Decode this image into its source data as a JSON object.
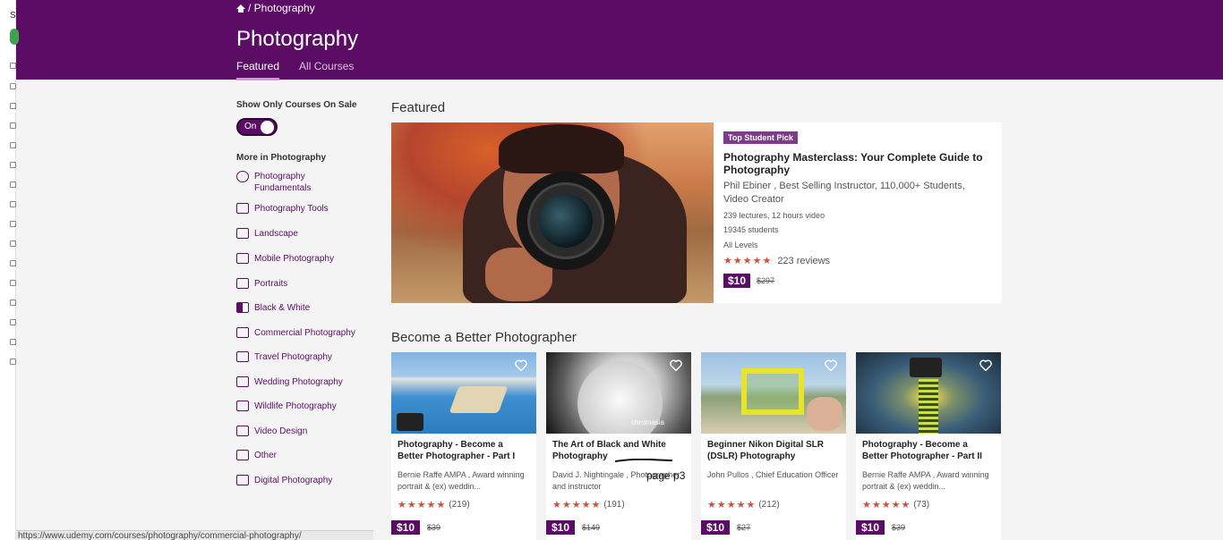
{
  "edge": {
    "letter": "S"
  },
  "header": {
    "breadcrumb": "/ Photography",
    "title": "Photography",
    "tabs": [
      {
        "label": "Featured",
        "active": true
      },
      {
        "label": "All Courses",
        "active": false
      }
    ],
    "colors": {
      "header_bg": "#5b0d66",
      "accent": "#d74c3c"
    }
  },
  "sidebar": {
    "sale_label": "Show Only Courses On Sale",
    "toggle_label": "On",
    "more_label": "More in Photography",
    "categories": [
      {
        "label": "Photography Fundamentals",
        "icon": "aperture-icon"
      },
      {
        "label": "Photography Tools",
        "icon": "tripod-icon"
      },
      {
        "label": "Landscape",
        "icon": "landscape-icon"
      },
      {
        "label": "Mobile Photography",
        "icon": "mobile-icon"
      },
      {
        "label": "Portraits",
        "icon": "portrait-icon"
      },
      {
        "label": "Black & White",
        "icon": "contrast-icon"
      },
      {
        "label": "Commercial Photography",
        "icon": "commercial-icon"
      },
      {
        "label": "Travel Photography",
        "icon": "travel-icon"
      },
      {
        "label": "Wedding Photography",
        "icon": "wedding-icon"
      },
      {
        "label": "Wildlife Photography",
        "icon": "wildlife-icon"
      },
      {
        "label": "Video Design",
        "icon": "video-icon"
      },
      {
        "label": "Other",
        "icon": "camera-icon"
      },
      {
        "label": "Digital Photography",
        "icon": "digital-icon"
      }
    ]
  },
  "featured": {
    "section_title": "Featured",
    "badge": "Top Student Pick",
    "title": "Photography Masterclass: Your Complete Guide to Photography",
    "author": "Phil Ebiner , Best Selling Instructor, 110,000+ Students, Video Creator",
    "lectures": "239 lectures, 12 hours video",
    "students": "19345 students",
    "level": "All Levels",
    "stars": "★★★★★",
    "reviews": "223 reviews",
    "price": "$10",
    "old_price": "$297"
  },
  "section2": {
    "title": "Become a Better Photographer"
  },
  "cards": [
    {
      "title": "Photography - Become a Better Photographer - Part I",
      "author": "Bernie Raffe AMPA , Award winning portrait & (ex) weddin...",
      "stars": "★★★★★",
      "reviews": "(219)",
      "price": "$10",
      "old_price": "$39"
    },
    {
      "title": "The Art of Black and White Photography",
      "author": "David J. Nightingale , Photographer and instructor",
      "stars": "★★★★★",
      "reviews": "(191)",
      "price": "$10",
      "old_price": "$149",
      "image_brand": "chromasia"
    },
    {
      "title": "Beginner Nikon Digital SLR (DSLR) Photography",
      "author": "John Pullos , Chief Education Officer",
      "stars": "★★★★★",
      "reviews": "(212)",
      "price": "$10",
      "old_price": "$27"
    },
    {
      "title": "Photography - Become a Better Photographer - Part II",
      "author": "Bernie Raffe AMPA , Award winning portrait & (ex) weddin...",
      "stars": "★★★★★",
      "reviews": "(73)",
      "price": "$10",
      "old_price": "$39"
    }
  ],
  "annotation": {
    "note": "page p3"
  },
  "status_bar": {
    "url": "https://www.udemy.com/courses/photography/commercial-photography/"
  }
}
